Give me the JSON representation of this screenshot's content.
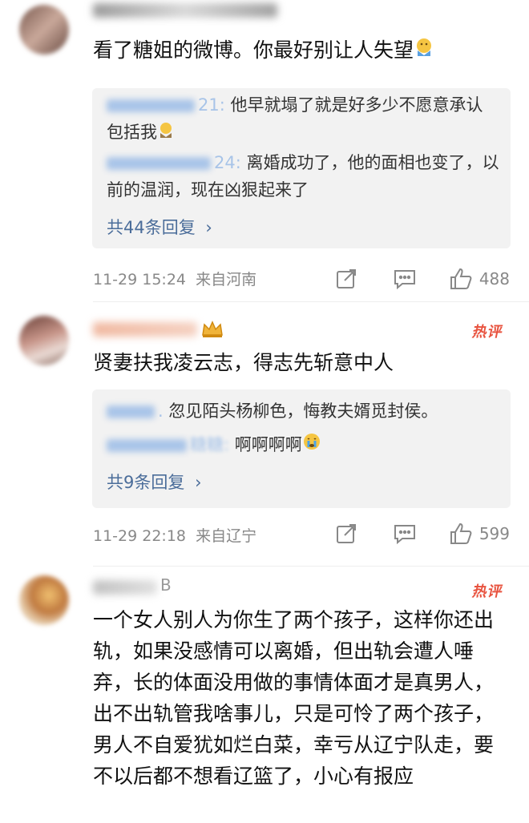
{
  "comments": [
    {
      "text": "看了糖姐的微博。你最好别让人失望",
      "replies": [
        {
          "name_suffix": "21:",
          "text": "他早就塌了就是好多少不愿意承认包括我"
        },
        {
          "name_suffix": "24:",
          "text": "离婚成功了，他的面相也变了，以前的温润，现在凶狠起来了"
        }
      ],
      "more": "共44条回复",
      "time": "11-29 15:24",
      "location": "来自河南",
      "likes": "488"
    },
    {
      "badge": "热评",
      "text": "贤妻扶我凌云志，得志先斩意中人",
      "replies": [
        {
          "name_suffix": ".",
          "text": "忽见陌头杨柳色，悔教夫婿觅封侯。"
        },
        {
          "name_suffix": "糖糖:",
          "text": "啊啊啊啊"
        }
      ],
      "more": "共9条回复",
      "time": "11-29 22:18",
      "location": "来自辽宁",
      "likes": "599"
    },
    {
      "badge": "热评",
      "name_suffix": "B",
      "text": "一个女人别人为你生了两个孩子，这样你还出轨，如果没感情可以离婚，但出轨会遭人唾弃，长的体面没用做的事情体面才是真男人，出不出轨管我啥事儿，只是可怜了两个孩子，男人不自爱犹如烂白菜，幸亏从辽宁队走，要不以后都不想看辽篮了，小心有报应"
    }
  ],
  "icons": {
    "share": "share-icon",
    "comment": "comment-icon",
    "like": "thumbs-up-icon",
    "emoji_pray": "praying-emoji-icon",
    "emoji_cry": "crying-emoji-icon",
    "crown": "crown-icon"
  },
  "colors": {
    "link": "#4b6d9a",
    "hot": "#e8533f",
    "meta": "#888888",
    "reply_bg": "#f2f2f2"
  }
}
